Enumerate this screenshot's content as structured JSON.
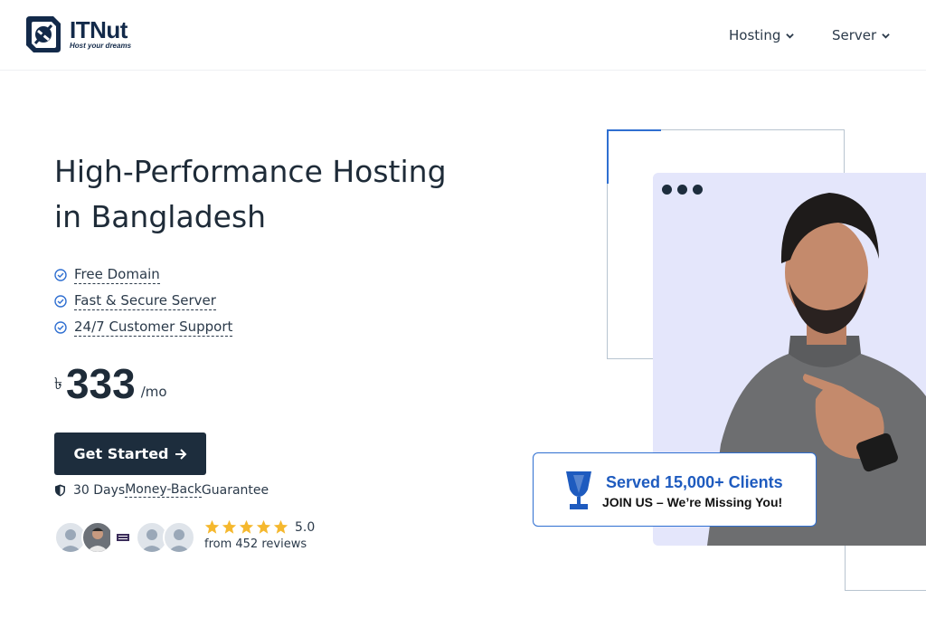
{
  "brand": {
    "name": "ITNut",
    "tagline": "Host your dreams"
  },
  "nav": [
    {
      "label": "Hosting"
    },
    {
      "label": "Server"
    }
  ],
  "hero": {
    "title_line1": "High-Performance Hosting",
    "title_line2": "in Bangladesh",
    "features": [
      "Free Domain",
      "Fast & Secure Server",
      "24/7 Customer Support"
    ],
    "price": {
      "currency": "৳",
      "amount": "333",
      "period": "/mo"
    },
    "cta_label": "Get Started",
    "guarantee": {
      "prefix": "30 Days ",
      "underlined": "Money-Back",
      "suffix": " Guarantee"
    },
    "rating": {
      "score": "5.0",
      "stars": 5,
      "reviews": "from 452 reviews"
    }
  },
  "badge": {
    "title": "Served 15,000+ Clients",
    "subtitle": "JOIN US – We’re Missing You!"
  },
  "colors": {
    "primary_dark": "#1d2d3d",
    "accent_blue": "#2f6fd1",
    "star": "#f5b82e",
    "browser_bg": "#e4e6fb"
  },
  "icons": [
    "logo-mark-icon",
    "chevron-down-icon",
    "check-circle-icon",
    "arrow-right-icon",
    "shield-icon",
    "star-icon",
    "trophy-icon"
  ]
}
